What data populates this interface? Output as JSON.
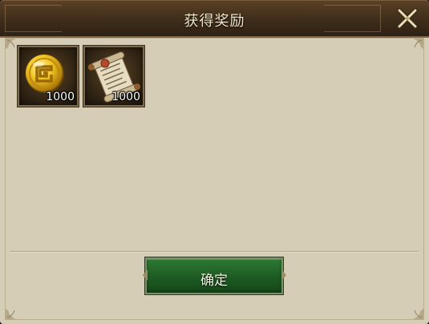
{
  "dialog": {
    "title": "获得奖励",
    "close_icon": "close-icon"
  },
  "rewards": [
    {
      "icon": "gold-coin-icon",
      "count": "1000"
    },
    {
      "icon": "scroll-icon",
      "count": "1000"
    }
  ],
  "actions": {
    "confirm_label": "确定"
  },
  "colors": {
    "panel_bg": "#d5cdb5",
    "header_bg": "#3f2d1b",
    "button_green": "#1d5a22",
    "title_text": "#efe4c8"
  }
}
